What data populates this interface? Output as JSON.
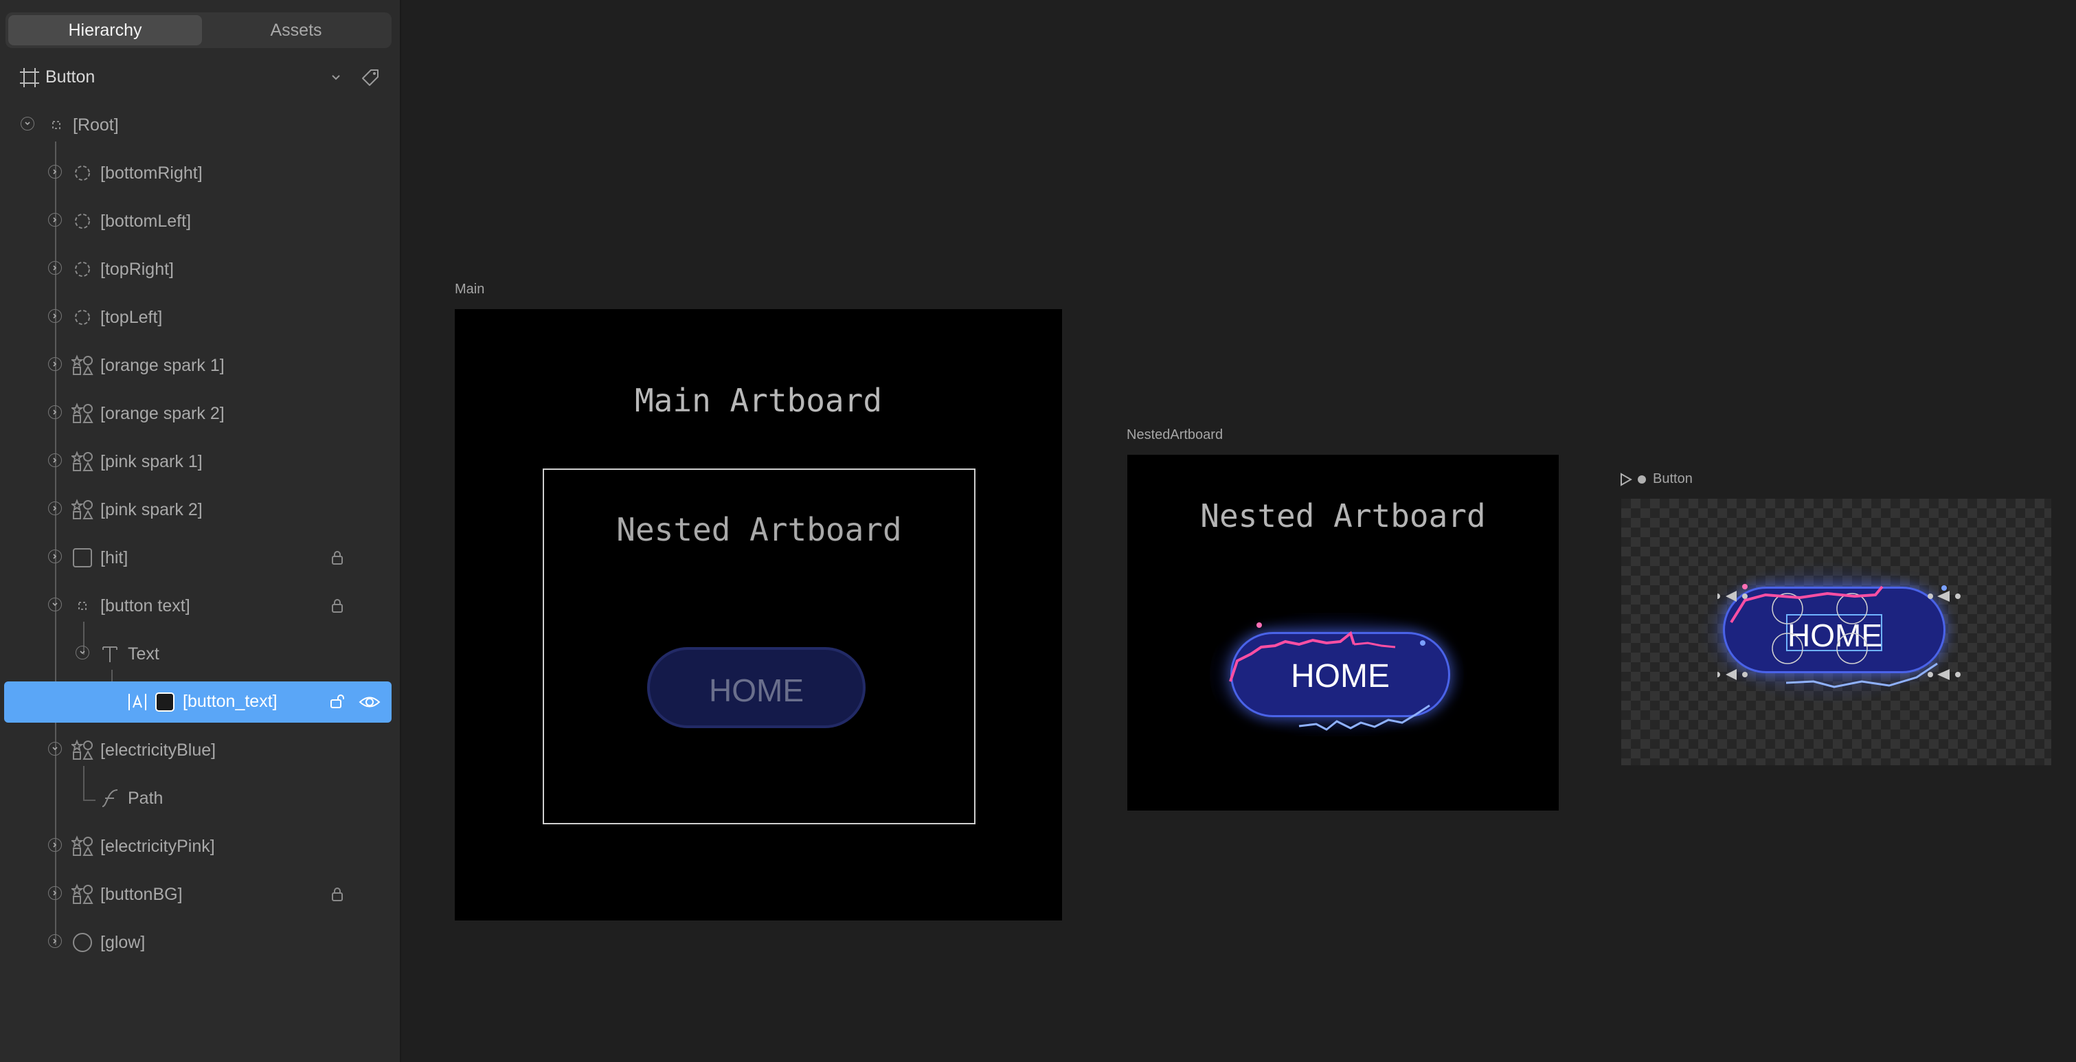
{
  "sidebar": {
    "tabs": [
      {
        "label": "Hierarchy"
      },
      {
        "label": "Assets"
      }
    ],
    "artboard_select": {
      "label": "Button"
    },
    "tree": [
      {
        "label": "[Root]",
        "icon": "group-icon",
        "expanded": true
      },
      {
        "label": "[bottomRight]",
        "icon": "target-icon"
      },
      {
        "label": "[bottomLeft]",
        "icon": "target-icon"
      },
      {
        "label": "[topRight]",
        "icon": "target-icon"
      },
      {
        "label": "[topLeft]",
        "icon": "target-icon"
      },
      {
        "label": "[orange spark 1]",
        "icon": "shapes-icon"
      },
      {
        "label": "[orange spark 2]",
        "icon": "shapes-icon"
      },
      {
        "label": "[pink spark 1]",
        "icon": "shapes-icon"
      },
      {
        "label": "[pink spark 2]",
        "icon": "shapes-icon"
      },
      {
        "label": "[hit]",
        "icon": "rectangle-icon",
        "locked": true
      },
      {
        "label": "[button text]",
        "icon": "group-icon",
        "locked": true,
        "expanded": true
      },
      {
        "label": "Text",
        "icon": "text-icon",
        "expanded": true
      },
      {
        "label": "[button_text]",
        "icon": "text-run-icon",
        "selected": true
      },
      {
        "label": "[electricityBlue]",
        "icon": "shapes-icon",
        "expanded": true
      },
      {
        "label": "Path",
        "icon": "path-icon"
      },
      {
        "label": "[electricityPink]",
        "icon": "shapes-icon"
      },
      {
        "label": "[buttonBG]",
        "icon": "shapes-icon",
        "locked": true
      },
      {
        "label": "[glow]",
        "icon": "ellipse-icon"
      }
    ]
  },
  "canvas": {
    "main": {
      "title": "Main",
      "heading": "Main Artboard",
      "nested_heading": "Nested Artboard",
      "button_label": "HOME"
    },
    "nested": {
      "title": "NestedArtboard",
      "heading": "Nested Artboard",
      "button_label": "HOME"
    },
    "button": {
      "title": "Button",
      "button_label": "HOME"
    }
  },
  "colors": {
    "selection": "#5aa6f7",
    "button_fill": "#1c2380",
    "neon_pink": "#ff4fa3",
    "neon_blue": "#6a8bff"
  }
}
